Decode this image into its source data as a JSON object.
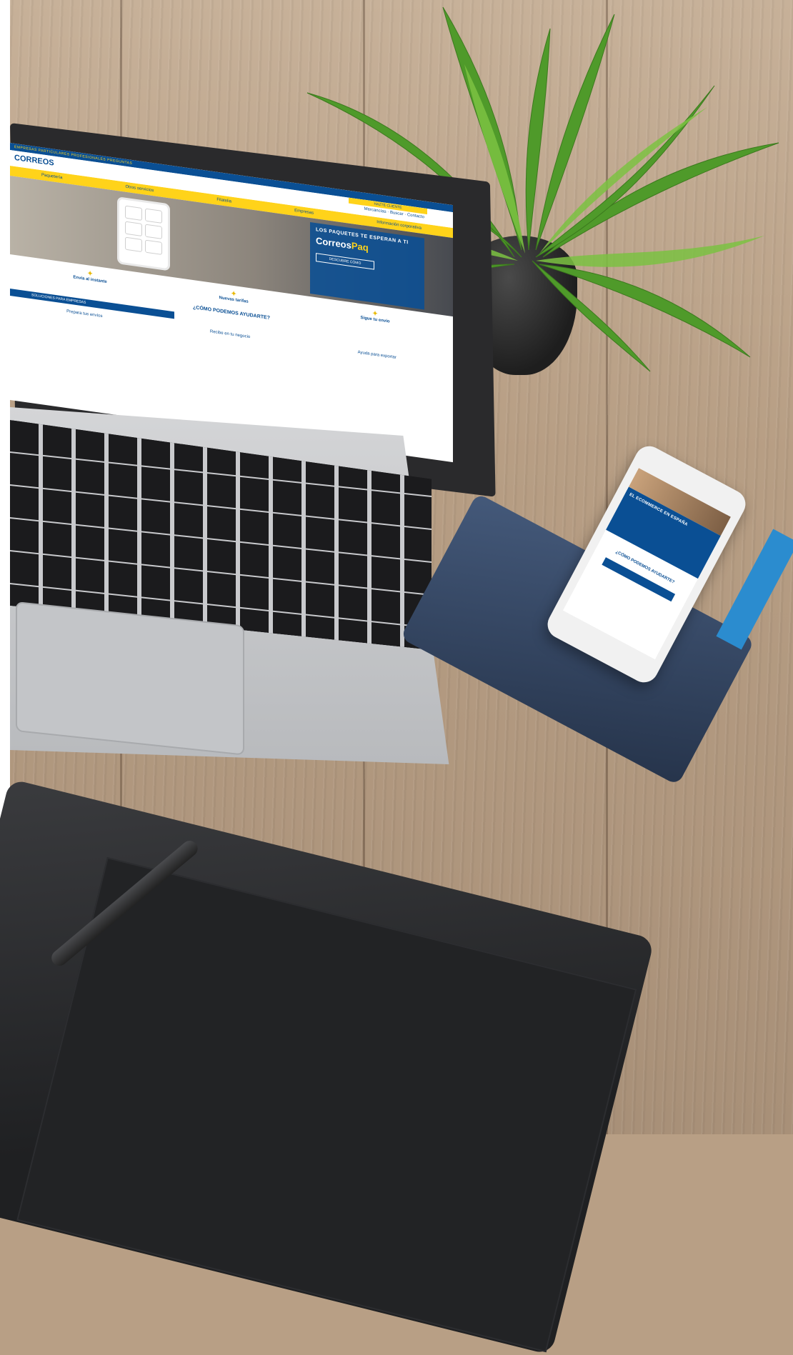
{
  "website": {
    "top_links": "EMPRESAS  PARTICULARES  PROFESIONALES  PREGUNTAS",
    "logo": "CORREOS",
    "cta": "HAZTE CLIENTE",
    "util_links": "Mercancías · Buscar · Contacto",
    "nav": [
      "Paquetería",
      "Otros servicios",
      "Filatelia",
      "Empresas",
      "Información corporativa"
    ],
    "hero_heading": "LOS PAQUETES TE ESPERAN A TI",
    "hero_brand_prefix": "Correos",
    "hero_brand_suffix": "Paq",
    "hero_button": "DESCUBRE CÓMO",
    "features": [
      "Envía al instante",
      "Nuevas tarifas",
      "Sigue tu envío"
    ],
    "help_title": "¿CÓMO PODEMOS AYUDARTE?",
    "tab": "SOLUCIONES PARA EMPRESAS",
    "services": [
      "Prepara tus envíos",
      "Recibe en tu negocio",
      "Ayuda para exportar"
    ]
  },
  "phone": {
    "band_title": "EL ECOMMERCE EN ESPAÑA",
    "body_title": "¿CÓMO PODEMOS AYUDARTE?"
  },
  "colors": {
    "brand_blue": "#0a4f94",
    "brand_yellow": "#ffd31a",
    "accent_red": "#9b2638"
  }
}
